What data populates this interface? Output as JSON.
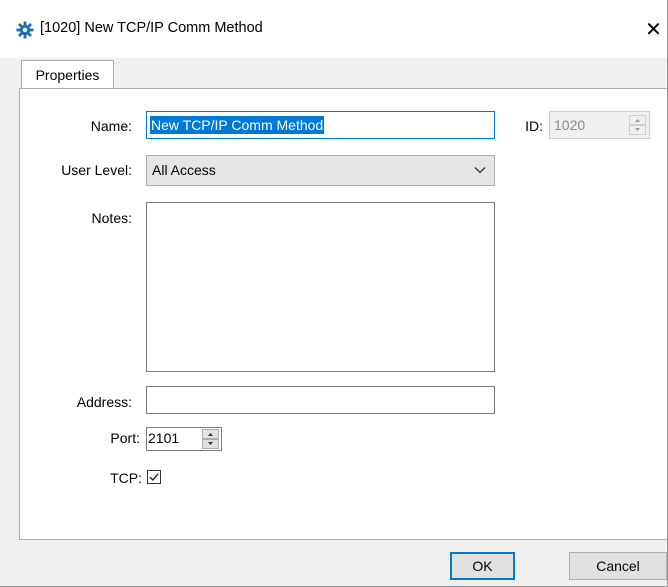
{
  "window": {
    "title": "[1020] New TCP/IP Comm Method",
    "close_glyph": "✕"
  },
  "tabs": [
    {
      "label": "Properties",
      "selected": true
    }
  ],
  "form": {
    "name_label": "Name:",
    "name_value": "New TCP/IP Comm Method",
    "id_label": "ID:",
    "id_value": "1020",
    "user_level_label": "User Level:",
    "user_level_value": "All Access",
    "notes_label": "Notes:",
    "notes_value": "",
    "address_label": "Address:",
    "address_value": "",
    "port_label": "Port:",
    "port_value": "2101",
    "tcp_label": "TCP:",
    "tcp_checked": true
  },
  "buttons": {
    "ok_label": "OK",
    "cancel_label": "Cancel"
  },
  "colors": {
    "accent": "#0078d7",
    "window_bg": "#f0f0f0",
    "icon_blue": "#1f6fb5"
  },
  "icons": [
    "gear-icon",
    "close-icon",
    "chevron-down-icon",
    "spin-up-icon",
    "spin-down-icon",
    "checkmark-icon"
  ]
}
